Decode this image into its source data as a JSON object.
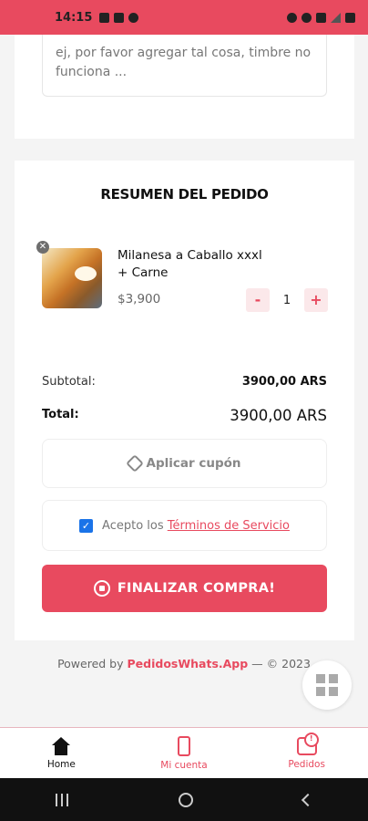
{
  "status": {
    "time": "14:15"
  },
  "notes": {
    "text": "ej, por favor agregar tal cosa, timbre no funciona ..."
  },
  "order": {
    "title": "RESUMEN DEL PEDIDO",
    "item": {
      "name": "Milanesa a Caballo xxxl",
      "modifier": "+ Carne",
      "price": "$3,900",
      "quantity": "1"
    },
    "subtotal_label": "Subtotal:",
    "subtotal_value": "3900,00 ARS",
    "total_label": "Total:",
    "total_value": "3900,00 ARS"
  },
  "coupon": {
    "label": "Aplicar cupón"
  },
  "terms": {
    "prefix": "Acepto los ",
    "link": "Términos de Servicio",
    "checked": true
  },
  "checkout": {
    "label": "FINALIZAR COMPRA!"
  },
  "footer": {
    "prefix": "Powered by ",
    "brand": "PedidosWhats.App",
    "suffix": " — © 2023"
  },
  "nav": {
    "home": "Home",
    "account": "Mi cuenta",
    "orders": "Pedidos"
  },
  "colors": {
    "accent": "#e84a5f",
    "checkbox": "#1a73e8"
  }
}
